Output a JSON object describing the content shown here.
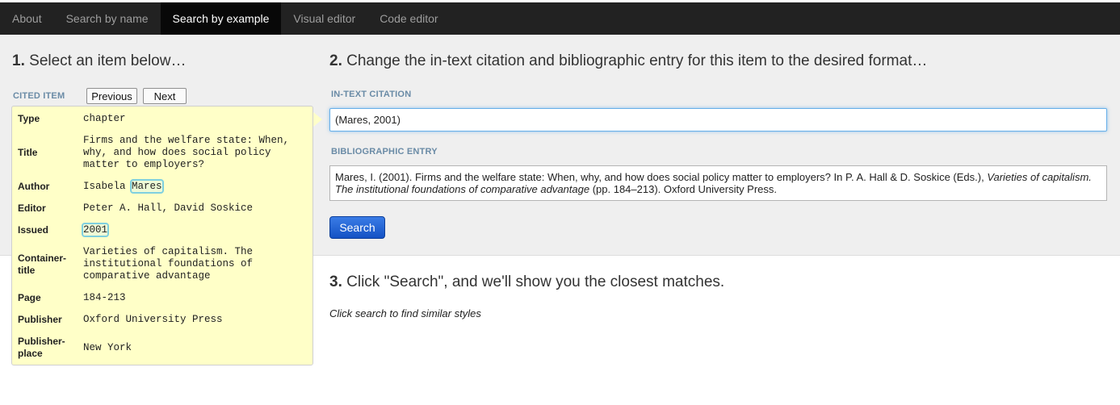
{
  "nav": {
    "tabs": [
      {
        "label": "About"
      },
      {
        "label": "Search by name"
      },
      {
        "label": "Search by example"
      },
      {
        "label": "Visual editor"
      },
      {
        "label": "Code editor"
      }
    ],
    "active_index": 2
  },
  "step1": {
    "number": "1.",
    "text": "Select an item below…"
  },
  "step2": {
    "number": "2.",
    "text": "Change the in-text citation and bibliographic entry for this item to the desired format…"
  },
  "step3": {
    "number": "3.",
    "text": "Click \"Search\", and we'll show you the closest matches."
  },
  "cited_item": {
    "label": "CITED ITEM",
    "previous_label": "Previous",
    "next_label": "Next",
    "fields": {
      "type": {
        "label": "Type",
        "value": "chapter"
      },
      "title": {
        "label": "Title",
        "value": "Firms and the welfare state: When, why, and how does social policy matter to employers?"
      },
      "author": {
        "label": "Author",
        "value_plain": "Isabela ",
        "value_highlight": "Mares"
      },
      "editor": {
        "label": "Editor",
        "value": "Peter A. Hall, David Soskice"
      },
      "issued": {
        "label": "Issued",
        "value": "2001"
      },
      "container_title": {
        "label": "Container-title",
        "value": "Varieties of capitalism. The institutional foundations of comparative advantage"
      },
      "page": {
        "label": "Page",
        "value": "184-213"
      },
      "publisher": {
        "label": "Publisher",
        "value": "Oxford University Press"
      },
      "publisher_place": {
        "label": "Publisher-place",
        "value": "New York"
      }
    }
  },
  "in_text_citation": {
    "label": "IN-TEXT CITATION",
    "value": "(Mares, 2001)"
  },
  "bibliographic_entry": {
    "label": "BIBLIOGRAPHIC ENTRY",
    "part1": "Mares, I. (2001). Firms and the welfare state: When, why, and how does social policy matter to employers? In P. A. Hall & D. Soskice (Eds.), ",
    "italic": "Varieties of capitalism. The institutional foundations of comparative advantage",
    "part2": " (pp. 184–213). Oxford University Press."
  },
  "search_button": {
    "label": "Search"
  },
  "results_hint": "Click search to find similar styles",
  "colors": {
    "navbar_bg": "#222222",
    "active_tab_bg": "#080808",
    "item_box_bg": "#ffffc8",
    "section_label": "#6a8ba6",
    "search_button": "#1a5fd0"
  }
}
